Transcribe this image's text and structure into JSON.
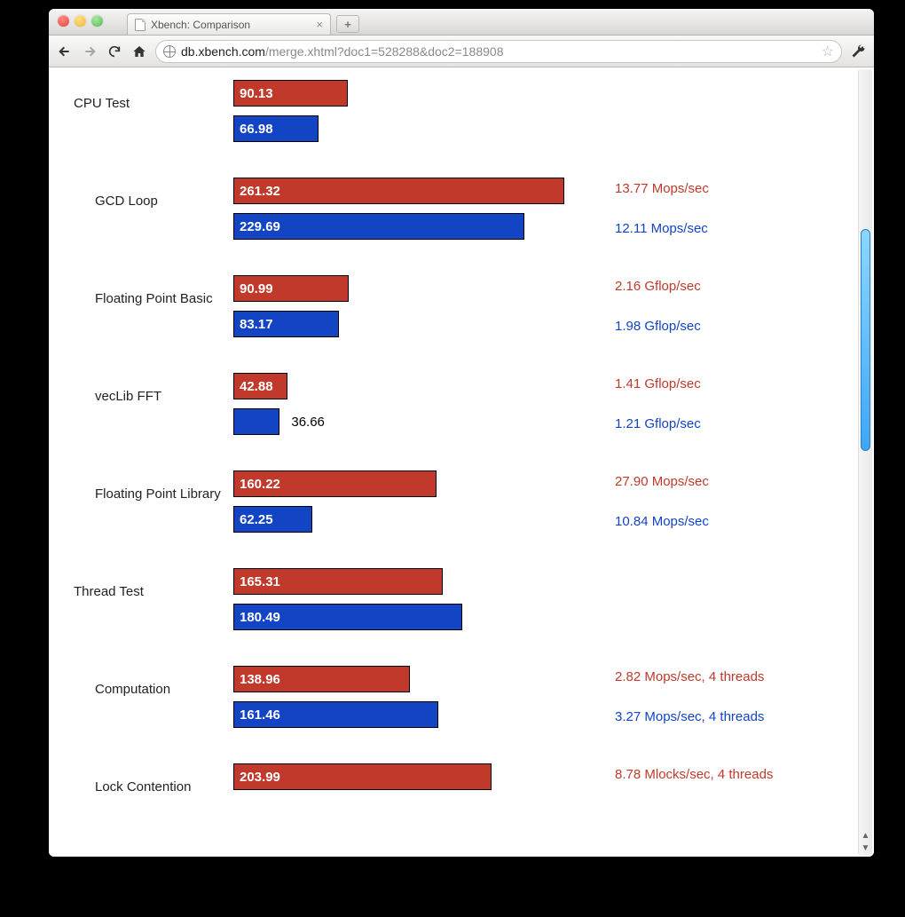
{
  "browser": {
    "tab_title": "Xbench: Comparison",
    "url_domain": "db.xbench.com",
    "url_path": "/merge.xhtml?doc1=528288&doc2=188908"
  },
  "chart_data": {
    "type": "bar",
    "max_scale": 280,
    "series_colors": {
      "a": "#c0392b",
      "b": "#1244c4"
    },
    "rows": [
      {
        "label": "CPU Test",
        "indent": false,
        "a": {
          "value": 90.13,
          "metric": ""
        },
        "b": {
          "value": 66.98,
          "metric": ""
        }
      },
      {
        "label": "GCD Loop",
        "indent": true,
        "a": {
          "value": 261.32,
          "metric": "13.77 Mops/sec"
        },
        "b": {
          "value": 229.69,
          "metric": "12.11 Mops/sec"
        }
      },
      {
        "label": "Floating Point Basic",
        "indent": true,
        "a": {
          "value": 90.99,
          "metric": "2.16 Gflop/sec"
        },
        "b": {
          "value": 83.17,
          "metric": "1.98 Gflop/sec"
        }
      },
      {
        "label": "vecLib FFT",
        "indent": true,
        "a": {
          "value": 42.88,
          "metric": "1.41 Gflop/sec"
        },
        "b": {
          "value": 36.66,
          "metric": "1.21 Gflop/sec",
          "outside": true
        }
      },
      {
        "label": "Floating Point Library",
        "indent": true,
        "a": {
          "value": 160.22,
          "metric": "27.90 Mops/sec"
        },
        "b": {
          "value": 62.25,
          "metric": "10.84 Mops/sec"
        }
      },
      {
        "label": "Thread Test",
        "indent": false,
        "a": {
          "value": 165.31,
          "metric": ""
        },
        "b": {
          "value": 180.49,
          "metric": ""
        }
      },
      {
        "label": "Computation",
        "indent": true,
        "a": {
          "value": 138.96,
          "metric": "2.82 Mops/sec, 4 threads"
        },
        "b": {
          "value": 161.46,
          "metric": "3.27 Mops/sec, 4 threads"
        }
      },
      {
        "label": "Lock Contention",
        "indent": true,
        "partial": true,
        "a": {
          "value": 203.99,
          "metric": "8.78 Mlocks/sec, 4 threads"
        },
        "b": {
          "value": null,
          "metric": ""
        }
      }
    ]
  }
}
